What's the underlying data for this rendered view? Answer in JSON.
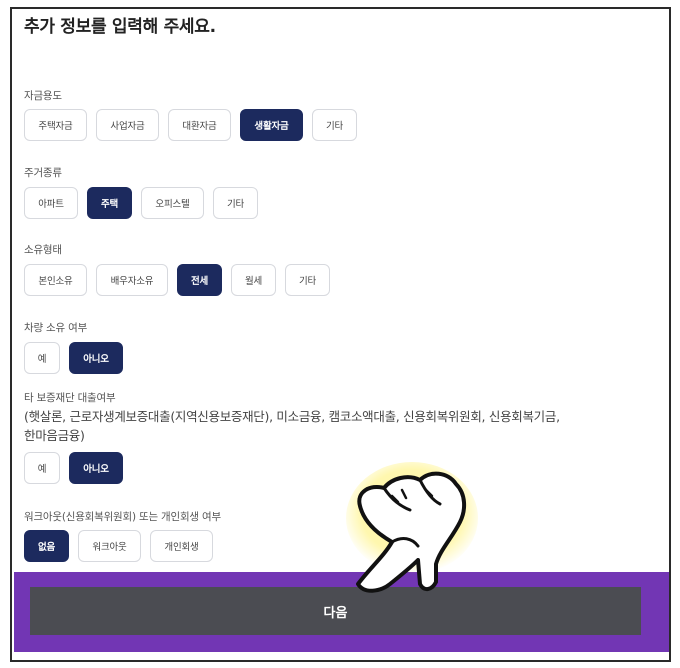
{
  "title": "추가 정보를 입력해 주세요.",
  "sections": [
    {
      "label": "자금용도",
      "options": [
        "주택자금",
        "사업자금",
        "대환자금",
        "생활자금",
        "기타"
      ],
      "selected": "생활자금"
    },
    {
      "label": "주거종류",
      "options": [
        "아파트",
        "주택",
        "오피스텔",
        "기타"
      ],
      "selected": "주택"
    },
    {
      "label": "소유형태",
      "options": [
        "본인소유",
        "배우자소유",
        "전세",
        "월세",
        "기타"
      ],
      "selected": "전세"
    },
    {
      "label": "차량 소유 여부",
      "options": [
        "예",
        "아니오"
      ],
      "selected": "아니오"
    },
    {
      "label": "타 보증재단 대출여부",
      "note_line1": "(햇살론, 근로자생계보증대출(지역신용보증재단), 미소금융, 캠코소액대출, 신용회복위원회, 신용회복기금,",
      "note_line2": "한마음금융)",
      "options": [
        "예",
        "아니오"
      ],
      "selected": "아니오"
    },
    {
      "label": "워크아웃(신용회복위원회) 또는 개인회생 여부",
      "options": [
        "없음",
        "워크아웃",
        "개인회생"
      ],
      "selected": "없음"
    }
  ],
  "next_button": "다음",
  "colors": {
    "selected": "#1c2a5e",
    "bar": "#7236b4",
    "button": "#4b4c52"
  },
  "icons": {
    "pointer": "pointing-hand-icon"
  }
}
